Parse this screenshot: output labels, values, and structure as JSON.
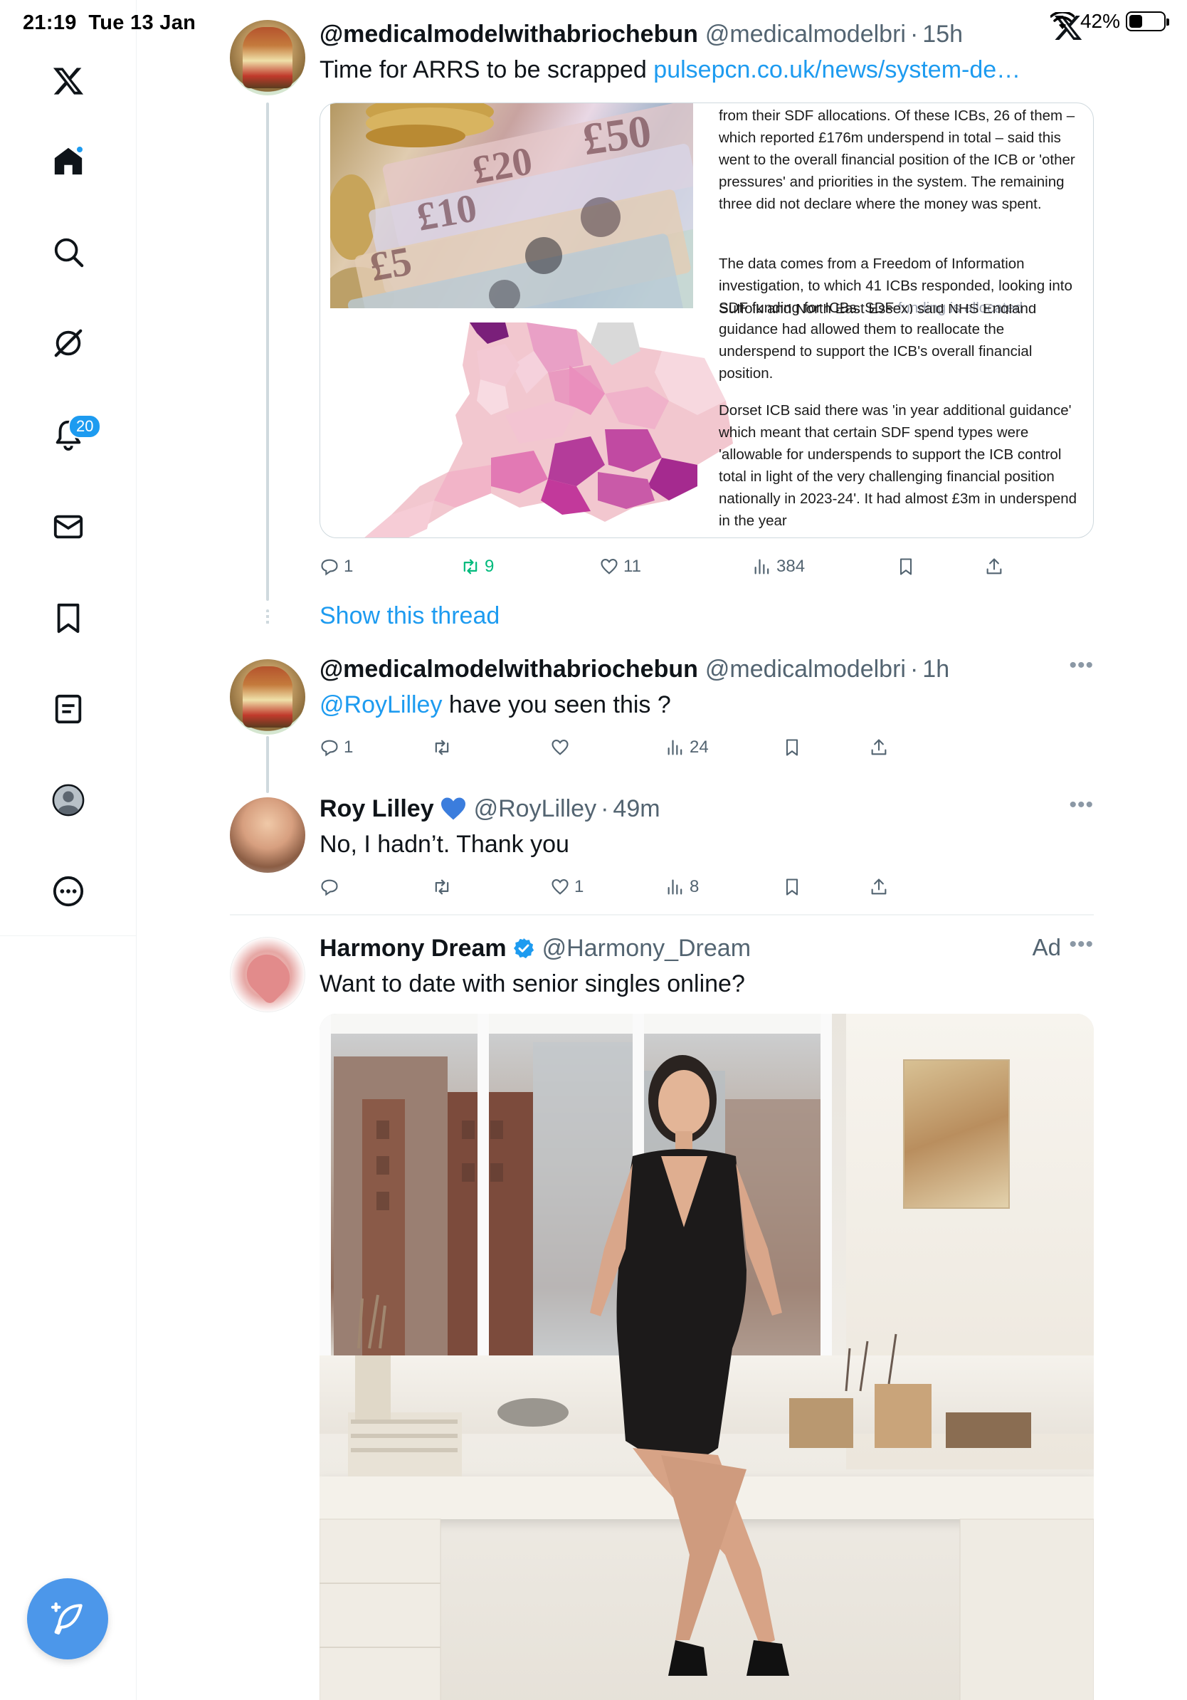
{
  "status_bar": {
    "time": "21:19",
    "date": "Tue 13 Jan",
    "battery_pct": "42%"
  },
  "sidebar": {
    "notifications_count": "20",
    "items": [
      "x-logo",
      "home",
      "explore",
      "grok",
      "notifications",
      "messages",
      "bookmarks",
      "lists",
      "profile",
      "more"
    ]
  },
  "tweets": [
    {
      "name": "@medicalmodelwithabriochebun",
      "handle": "@medicalmodelbri",
      "time": "15h",
      "text": "Time for ARRS to be scrapped ",
      "link": "pulsepcn.co.uk/news/system-de…",
      "article": {
        "para1": "from their SDF allocations. Of these ICBs, 26 of them – which reported £176m underspend in total – said this went to the overall financial position of the ICB or 'other pressures' and priorities in the system. The remaining three did not declare where the money was spent.",
        "para2_start": "The data comes from a Freedom of Information investigation, to which 41 ICBs responded, looking into SDF funding for ICBs. SDF ",
        "para2_faint": "funding is allocated",
        "para3_overlap": "Suffolk and North East Essex) said NHS England",
        "para3": "guidance had allowed them to reallocate the underspend to support the ICB's overall financial position.",
        "para4": "Dorset ICB said there was 'in year additional guidance' which meant that certain SDF spend types were 'allowable for underspends to support the ICB control total in light of the very challenging financial position nationally in 2023-24'. It had almost £3m in underspend in the year"
      },
      "replies": "1",
      "retweets": "9",
      "likes": "11",
      "views": "384"
    },
    {
      "name": "@medicalmodelwithabriochebun",
      "handle": "@medicalmodelbri",
      "time": "1h",
      "mention": "@RoyLilley",
      "text": " have you seen this ?",
      "replies": "1",
      "retweets": "",
      "likes": "",
      "views": "24"
    },
    {
      "name": "Roy Lilley",
      "handle": "@RoyLilley",
      "time": "49m",
      "text": "No, I hadn’t. Thank you",
      "replies": "",
      "retweets": "",
      "likes": "1",
      "views": "8"
    },
    {
      "name": "Harmony Dream",
      "handle": "@Harmony_Dream",
      "ad_label": "Ad",
      "text": "Want to date with senior singles online?"
    }
  ],
  "show_thread": "Show this thread",
  "banknotes": [
    "£50",
    "£20",
    "£10",
    "£5"
  ],
  "colors": {
    "accent": "#1d9bf0",
    "retweet_green": "#00ba7c",
    "compose": "#4c97ea",
    "text_secondary": "#536471"
  }
}
